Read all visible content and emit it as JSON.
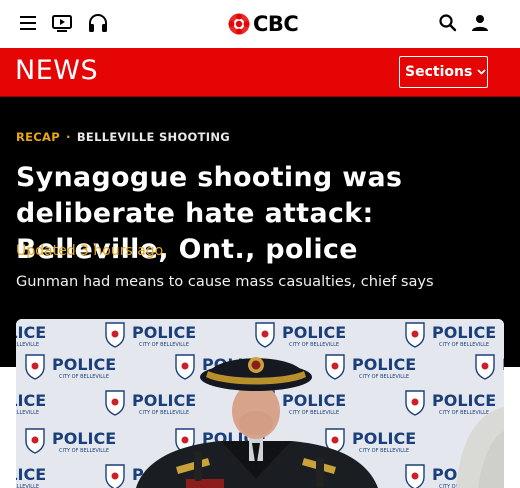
{
  "header": {
    "logo_text": "CBC",
    "icons": [
      "menu-icon",
      "tv-icon",
      "headphones-icon",
      "search-icon",
      "user-icon"
    ]
  },
  "newsbar": {
    "title": "NEWS",
    "sections_label": "Sections",
    "color": "#e60505"
  },
  "article": {
    "kicker_label": "RECAP",
    "kicker_topic": "BELLEVILLE SHOOTING",
    "headline": "Synagogue shooting was deliberate hate attack: Belleville, Ont., police",
    "updated": "Updated 3 hours ago",
    "dek": "Gunman had means to cause mass casualties, chief says"
  },
  "photo": {
    "backdrop_text": "POLICE",
    "backdrop_subtext": "CITY OF BELLEVILLE"
  },
  "colors": {
    "accent": "#e6a817",
    "background": "#000000",
    "brand_red": "#e60505"
  }
}
